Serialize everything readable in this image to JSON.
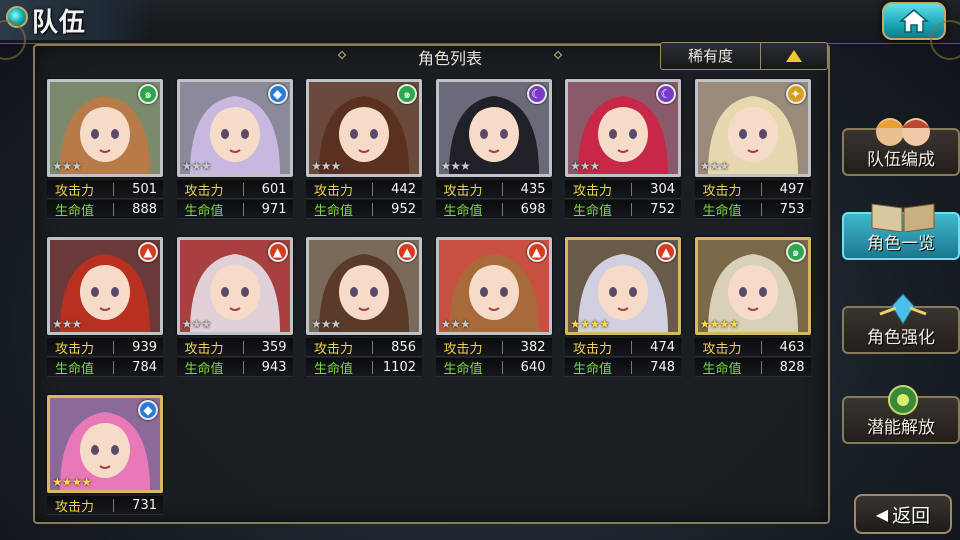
{
  "header": {
    "title": "队伍"
  },
  "panel": {
    "title": "角色列表",
    "sort_label": "稀有度"
  },
  "stat_labels": {
    "atk": "攻击力",
    "hp": "生命值"
  },
  "characters": [
    {
      "atk": "501",
      "hp": "888",
      "element": "wind",
      "frame": "silver",
      "stars": "★★★",
      "hair": "#b87a48",
      "bg": "#7a8a6a"
    },
    {
      "atk": "601",
      "hp": "971",
      "element": "water",
      "frame": "silver",
      "stars": "★★★",
      "hair": "#c8b8e0",
      "bg": "#8a8a9a"
    },
    {
      "atk": "442",
      "hp": "952",
      "element": "wind",
      "frame": "silver",
      "stars": "★★★",
      "hair": "#5a3020",
      "bg": "#6a4a3a"
    },
    {
      "atk": "435",
      "hp": "698",
      "element": "dark",
      "frame": "silver",
      "stars": "★★★",
      "hair": "#202028",
      "bg": "#6a6a78"
    },
    {
      "atk": "304",
      "hp": "752",
      "element": "dark",
      "frame": "silver",
      "stars": "★★★",
      "hair": "#c82848",
      "bg": "#8a5a6a"
    },
    {
      "atk": "497",
      "hp": "753",
      "element": "light",
      "frame": "silver",
      "stars": "★★★",
      "hair": "#e8d8b0",
      "bg": "#9a8a7a"
    },
    {
      "atk": "939",
      "hp": "784",
      "element": "fire",
      "frame": "silver",
      "stars": "★★★",
      "hair": "#b83020",
      "bg": "#6a3a3a"
    },
    {
      "atk": "359",
      "hp": "943",
      "element": "fire",
      "frame": "silver",
      "stars": "★★★",
      "hair": "#e0d0d8",
      "bg": "#a84040"
    },
    {
      "atk": "856",
      "hp": "1102",
      "element": "fire",
      "frame": "silver",
      "stars": "★★★",
      "hair": "#5a3a28",
      "bg": "#7a6a5a"
    },
    {
      "atk": "382",
      "hp": "640",
      "element": "fire",
      "frame": "silver",
      "stars": "★★★",
      "hair": "#a86a3a",
      "bg": "#c85040"
    },
    {
      "atk": "474",
      "hp": "748",
      "element": "fire",
      "frame": "gold",
      "stars": "★★★★",
      "hair": "#d0d0e0",
      "bg": "#6a5a4a"
    },
    {
      "atk": "463",
      "hp": "828",
      "element": "wind",
      "frame": "gold",
      "stars": "★★★★",
      "hair": "#d8d0b8",
      "bg": "#7a6a4a"
    },
    {
      "atk": "731",
      "hp": "",
      "element": "water",
      "frame": "gold",
      "stars": "★★★★",
      "hair": "#e878b8",
      "bg": "#8a6a98"
    }
  ],
  "side_menu": {
    "team": "队伍编成",
    "roster": "角色一览",
    "enhance": "角色强化",
    "awaken": "潜能解放"
  },
  "back": {
    "label": "返回",
    "icon": "arrow-left-icon"
  },
  "colors": {
    "accent": "#1aa6b6",
    "gold": "#d8b860",
    "atk": "#f0d050",
    "hp": "#7ad840"
  }
}
